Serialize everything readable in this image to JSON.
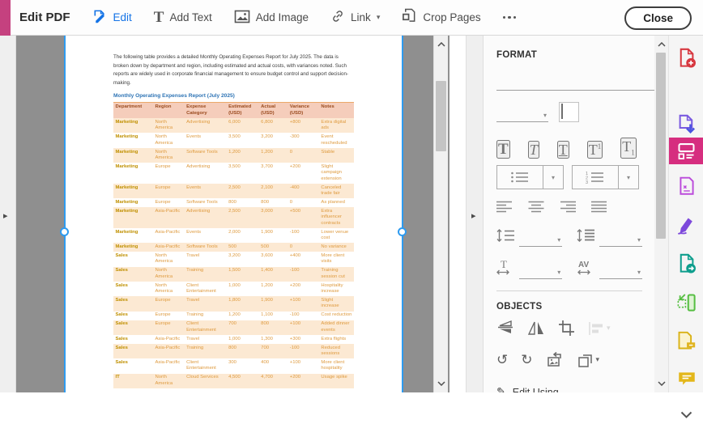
{
  "toolbar": {
    "title": "Edit PDF",
    "edit_label": "Edit",
    "add_text_label": "Add Text",
    "add_image_label": "Add Image",
    "link_label": "Link",
    "crop_pages_label": "Crop Pages",
    "close_label": "Close"
  },
  "icons": {
    "chevron_down": "▾",
    "panel_arrow": "▸",
    "rotate_ccw": "↺",
    "rotate_cw": "↻",
    "pencil": "✎"
  },
  "document": {
    "intro": "The following table provides a detailed Monthly Operating Expenses Report for July 2025. The data is broken down by department and region, including estimated and actual costs, with variances noted. Such reports are widely used in corporate financial management to ensure budget control and support decision-making.",
    "table_title": "Monthly Operating Expenses Report (July 2025)",
    "table": {
      "headers": [
        "Department",
        "Region",
        "Expense Category",
        "Estimated (USD)",
        "Actual (USD)",
        "Variance (USD)",
        "Notes"
      ],
      "rows": [
        [
          "Marketing",
          "North America",
          "Advertising",
          "6,000",
          "6,800",
          "+800",
          "Extra digital ads"
        ],
        [
          "Marketing",
          "North America",
          "Events",
          "3,500",
          "3,200",
          "-300",
          "Event rescheduled"
        ],
        [
          "Marketing",
          "North America",
          "Software Tools",
          "1,200",
          "1,200",
          "0",
          "Stable"
        ],
        [
          "Marketing",
          "Europe",
          "Advertising",
          "3,500",
          "3,700",
          "+200",
          "Slight campaign extension"
        ],
        [
          "Marketing",
          "Europe",
          "Events",
          "2,500",
          "2,100",
          "-400",
          "Canceled trade fair"
        ],
        [
          "Marketing",
          "Europe",
          "Software Tools",
          "800",
          "800",
          "0",
          "As planned"
        ],
        [
          "Marketing",
          "Asia-Pacific",
          "Advertising",
          "2,500",
          "3,000",
          "+500",
          "Extra influencer contracts"
        ],
        [
          "Marketing",
          "Asia-Pacific",
          "Events",
          "2,000",
          "1,900",
          "-100",
          "Lower venue cost"
        ],
        [
          "Marketing",
          "Asia-Pacific",
          "Software Tools",
          "500",
          "500",
          "0",
          "No variance"
        ],
        [
          "Sales",
          "North America",
          "Travel",
          "3,200",
          "3,600",
          "+400",
          "More client visits"
        ],
        [
          "Sales",
          "North America",
          "Training",
          "1,500",
          "1,400",
          "-100",
          "Training session cut"
        ],
        [
          "Sales",
          "North America",
          "Client Entertainment",
          "1,000",
          "1,200",
          "+200",
          "Hospitality increase"
        ],
        [
          "Sales",
          "Europe",
          "Travel",
          "1,800",
          "1,900",
          "+100",
          "Slight increase"
        ],
        [
          "Sales",
          "Europe",
          "Training",
          "1,200",
          "1,100",
          "-100",
          "Cost reduction"
        ],
        [
          "Sales",
          "Europe",
          "Client Entertainment",
          "700",
          "800",
          "+100",
          "Added dinner events"
        ],
        [
          "Sales",
          "Asia-Pacific",
          "Travel",
          "1,000",
          "1,300",
          "+300",
          "Extra flights"
        ],
        [
          "Sales",
          "Asia-Pacific",
          "Training",
          "800",
          "700",
          "-100",
          "Reduced sessions"
        ],
        [
          "Sales",
          "Asia-Pacific",
          "Client Entertainment",
          "300",
          "400",
          "+100",
          "More client hospitality"
        ],
        [
          "IT",
          "North America",
          "Cloud Services",
          "4,500",
          "4,700",
          "+200",
          "Usage spike"
        ]
      ]
    }
  },
  "format_panel": {
    "title": "FORMAT",
    "objects_title": "OBJECTS",
    "edit_using_label": "Edit Using",
    "font_value": "",
    "size_value": ""
  },
  "right_rail": {
    "icons": [
      {
        "name": "create-pdf-icon",
        "color": "#d7373f"
      },
      {
        "name": "convert-pdf-icon",
        "color": "#5b5fe8"
      },
      {
        "name": "edit-pdf-tool-icon",
        "color": "#d62e7f",
        "selected": true
      },
      {
        "name": "prepare-form-icon",
        "color": "#bb4bdb"
      },
      {
        "name": "fill-sign-icon",
        "color": "#7d49db"
      },
      {
        "name": "export-pdf-icon",
        "color": "#0e9e8d"
      },
      {
        "name": "crop-resize-icon",
        "color": "#56be42"
      },
      {
        "name": "document-comment-icon",
        "color": "#d9b216"
      },
      {
        "name": "comment-icon",
        "color": "#e3b71a"
      },
      {
        "name": "more-tools-icon",
        "color": "#555555"
      }
    ]
  },
  "colors": {
    "accent_pink": "#c5417f",
    "selected_tool_pink": "#d62e7f",
    "edit_blue": "#1473e6",
    "selection_blue": "#2e9bf0",
    "viewer_gray": "#8f8f8f",
    "table_title_blue": "#2e74b5",
    "table_header_bg": "#f5cdbb",
    "table_header_text": "#9a4a1e",
    "table_band_bg": "#fce9d3",
    "table_cell_text": "#de9a3e",
    "table_dept_text": "#c09000"
  }
}
